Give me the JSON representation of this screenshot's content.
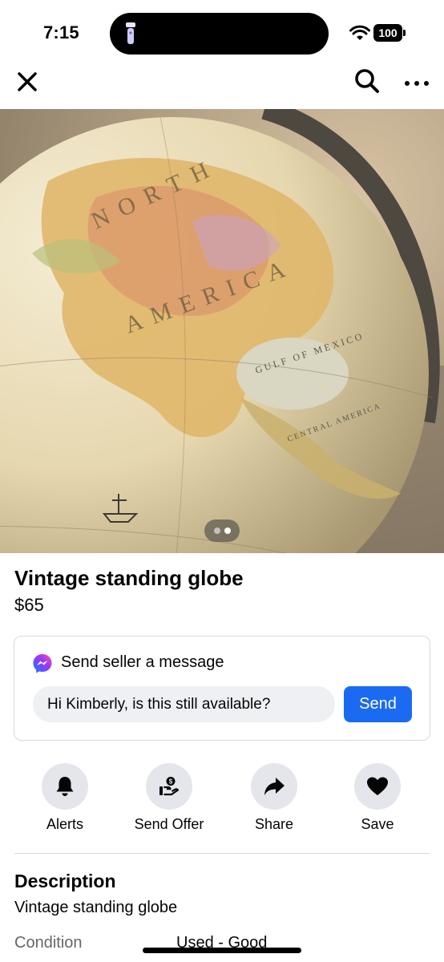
{
  "status_bar": {
    "time": "7:15",
    "battery": "100",
    "icons": [
      "flashlight-icon",
      "wifi-icon",
      "battery-icon"
    ]
  },
  "nav": {
    "icons": [
      "close-icon",
      "search-icon",
      "more-icon"
    ]
  },
  "photo": {
    "map_labels": [
      "NORTH",
      "AMERICA",
      "GULF OF MEXICO",
      "CENTRAL AMERICA"
    ],
    "pager": {
      "count": 2,
      "active_index": 1
    }
  },
  "listing": {
    "title": "Vintage standing globe",
    "price": "$65"
  },
  "message": {
    "icon": "messenger-icon",
    "heading": "Send seller a message",
    "input_value": "Hi Kimberly, is this still available?",
    "send_label": "Send",
    "send_color": "#1b6af2"
  },
  "actions": [
    {
      "label": "Alerts",
      "icon": "bell-icon"
    },
    {
      "label": "Send Offer",
      "icon": "offer-icon"
    },
    {
      "label": "Share",
      "icon": "share-icon"
    },
    {
      "label": "Save",
      "icon": "heart-icon"
    }
  ],
  "description": {
    "heading": "Description",
    "text": "Vintage standing globe"
  },
  "details": {
    "condition_label": "Condition",
    "condition_value": "Used - Good"
  }
}
